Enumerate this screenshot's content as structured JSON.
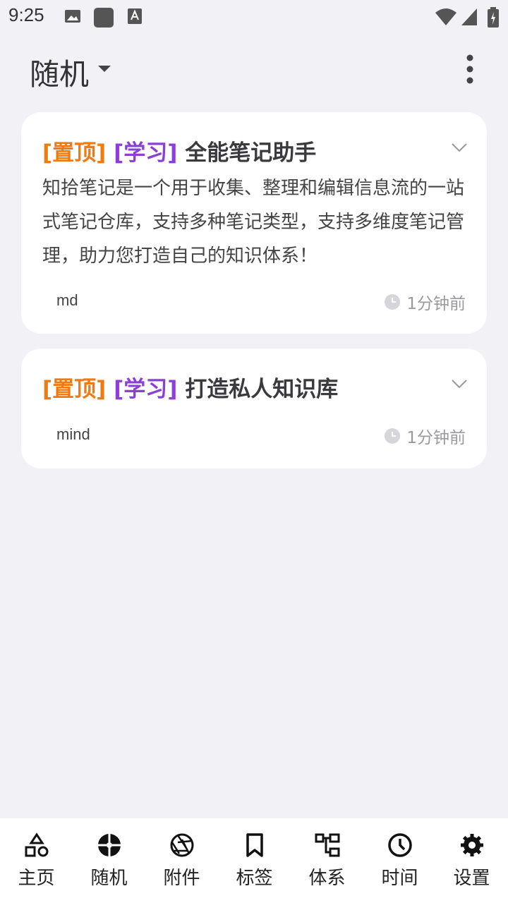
{
  "status_bar": {
    "time": "9:25"
  },
  "app_bar": {
    "title": "随机"
  },
  "notes": [
    {
      "pin_tag": "[置顶]",
      "category_tag": "[学习]",
      "title": "全能笔记助手",
      "body": "知拾笔记是一个用于收集、整理和编辑信息流的一站式笔记仓库，支持多种笔记类型，支持多维度笔记管理，助力您打造自己的知识体系！",
      "type": "md",
      "time": "1分钟前"
    },
    {
      "pin_tag": "[置顶]",
      "category_tag": "[学习]",
      "title": "打造私人知识库",
      "type": "mind",
      "time": "1分钟前"
    }
  ],
  "bottom_nav": {
    "items": [
      {
        "label": "主页",
        "icon": "shapes-icon"
      },
      {
        "label": "随机",
        "icon": "random-icon"
      },
      {
        "label": "附件",
        "icon": "aperture-icon"
      },
      {
        "label": "标签",
        "icon": "bookmark-icon"
      },
      {
        "label": "体系",
        "icon": "hierarchy-icon"
      },
      {
        "label": "时间",
        "icon": "clock-icon"
      },
      {
        "label": "设置",
        "icon": "gear-icon"
      }
    ]
  },
  "colors": {
    "pin_tag": "#f07a12",
    "category_tag": "#8a3fd6",
    "background": "#f2f1f6"
  }
}
